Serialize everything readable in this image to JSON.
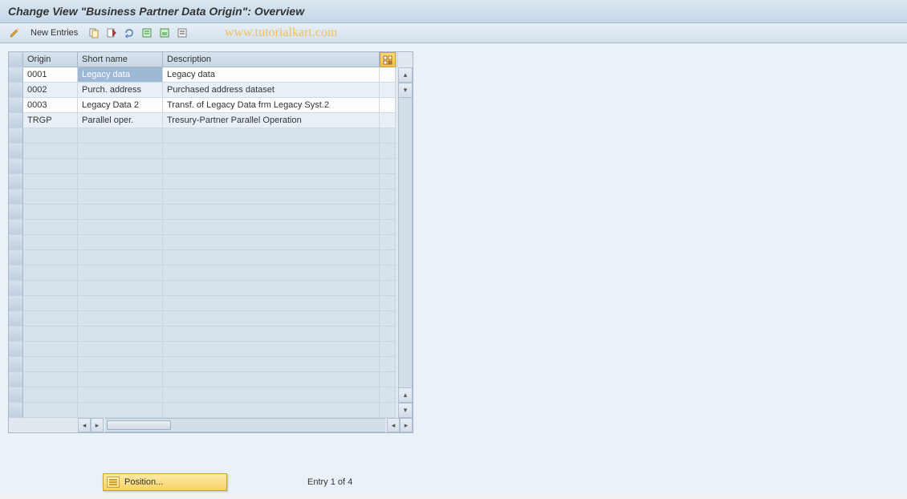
{
  "header": {
    "title": "Change View \"Business Partner Data Origin\": Overview"
  },
  "toolbar": {
    "new_entries_label": "New Entries",
    "watermark": "www.tutorialkart.com"
  },
  "table": {
    "headers": {
      "origin": "Origin",
      "short_name": "Short name",
      "description": "Description"
    },
    "rows": [
      {
        "origin": "0001",
        "short_name": "Legacy data",
        "description": "Legacy data",
        "selected": true
      },
      {
        "origin": "0002",
        "short_name": "Purch. address",
        "description": "Purchased address dataset",
        "selected": false
      },
      {
        "origin": "0003",
        "short_name": "Legacy Data 2",
        "description": "Transf. of Legacy Data frm Legacy Syst.2",
        "selected": false
      },
      {
        "origin": "TRGP",
        "short_name": "Parallel oper.",
        "description": "Tresury-Partner Parallel Operation",
        "selected": false
      }
    ],
    "empty_rows_count": 19
  },
  "footer": {
    "position_label": "Position...",
    "entry_status": "Entry 1 of 4"
  }
}
